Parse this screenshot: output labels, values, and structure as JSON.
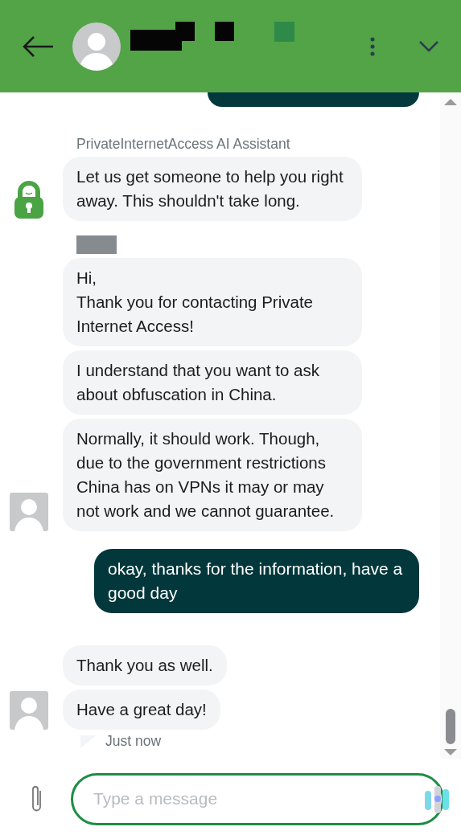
{
  "header": {
    "redacted_title": true
  },
  "messages": [
    {
      "kind": "outgoing_partial"
    },
    {
      "kind": "incoming",
      "avatar": {
        "kind": "bot"
      },
      "sender": "PrivateInternetAccess AI Assistant",
      "bubbles": [
        "Let us get someone to help you right away. This shouldn't take long."
      ]
    },
    {
      "kind": "incoming",
      "avatar": {
        "kind": "person"
      },
      "sender_redacted": true,
      "bubbles": [
        "Hi,\nThank you for contacting Private Internet Access!",
        "I understand that you want to ask about obfuscation in China.",
        "Normally, it should work. Though, due to the government restrictions China has on VPNs it may or may not work and we cannot guarantee."
      ]
    },
    {
      "kind": "outgoing",
      "bubbles": [
        "okay, thanks for the information, have a good day"
      ]
    },
    {
      "kind": "incoming",
      "avatar": {
        "kind": "person"
      },
      "bubbles": [
        "Thank you as well.",
        "Have a great day!"
      ],
      "time": "Just now"
    }
  ],
  "composer": {
    "placeholder": "Type a message"
  }
}
